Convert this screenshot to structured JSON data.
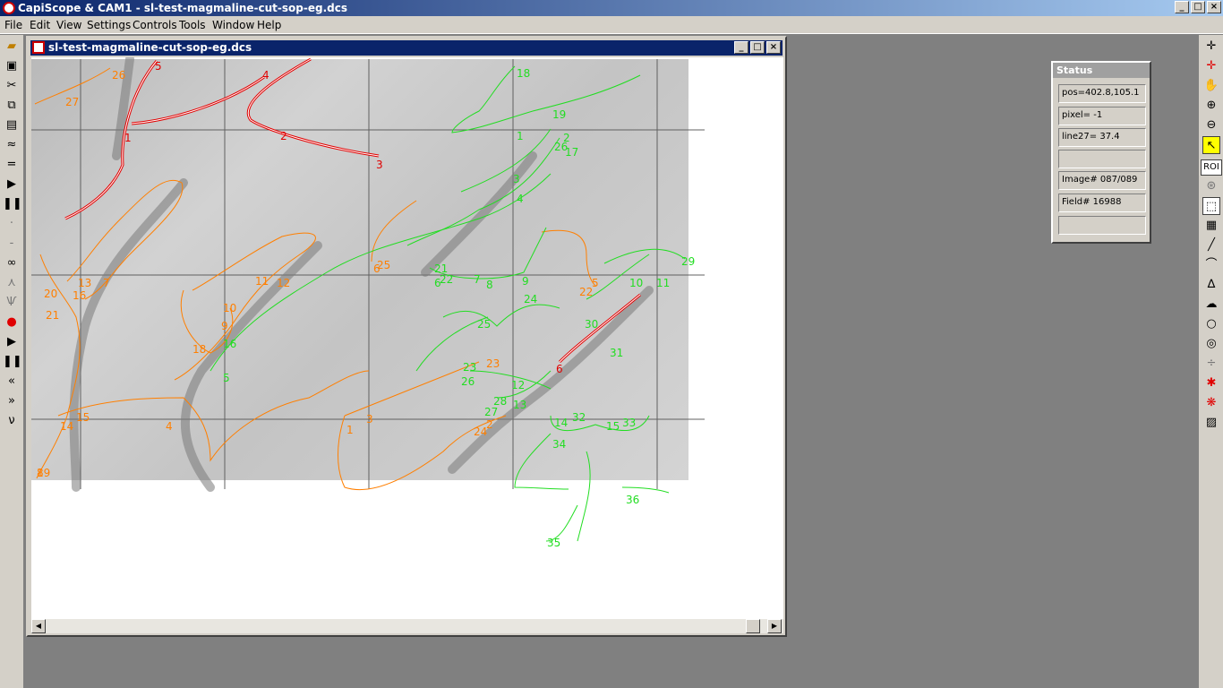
{
  "app": {
    "title": "CapiScope & CAM1 - sl-test-magmaline-cut-sop-eg.dcs"
  },
  "menu": [
    "File",
    "Edit",
    "View",
    "Settings",
    "Controls",
    "Tools",
    "Window",
    "Help"
  ],
  "document": {
    "title": "sl-test-magmaline-cut-sop-eg.dcs"
  },
  "status": {
    "title": "Status",
    "fields": [
      "pos=402.8,105.1",
      "pixel= -1",
      "line27= 37.4",
      "",
      "Image# 087/089",
      "Field# 16988",
      ""
    ]
  },
  "toolbar_right": {
    "roi_label": "ROI"
  },
  "colors": {
    "orange": "#ff7f00",
    "green": "#22dd22",
    "red": "#e00000"
  },
  "labels": {
    "red": [
      "5",
      "4",
      "1",
      "2",
      "3",
      "6"
    ],
    "orange": [
      "26",
      "27",
      "25",
      "6",
      "20",
      "21",
      "13",
      "16",
      "7",
      "11",
      "12",
      "10",
      "9",
      "18",
      "5",
      "22",
      "23",
      "3",
      "1",
      "24",
      "2",
      "8",
      "4",
      "19",
      "14",
      "15"
    ],
    "green": [
      "18",
      "19",
      "1",
      "2",
      "26",
      "17",
      "3",
      "4",
      "21",
      "22",
      "7",
      "8",
      "9",
      "24",
      "6",
      "25",
      "30",
      "31",
      "10",
      "11",
      "29",
      "16",
      "5",
      "23",
      "26",
      "12",
      "13",
      "28",
      "27",
      "14",
      "32",
      "15",
      "33",
      "34",
      "35",
      "36"
    ]
  }
}
